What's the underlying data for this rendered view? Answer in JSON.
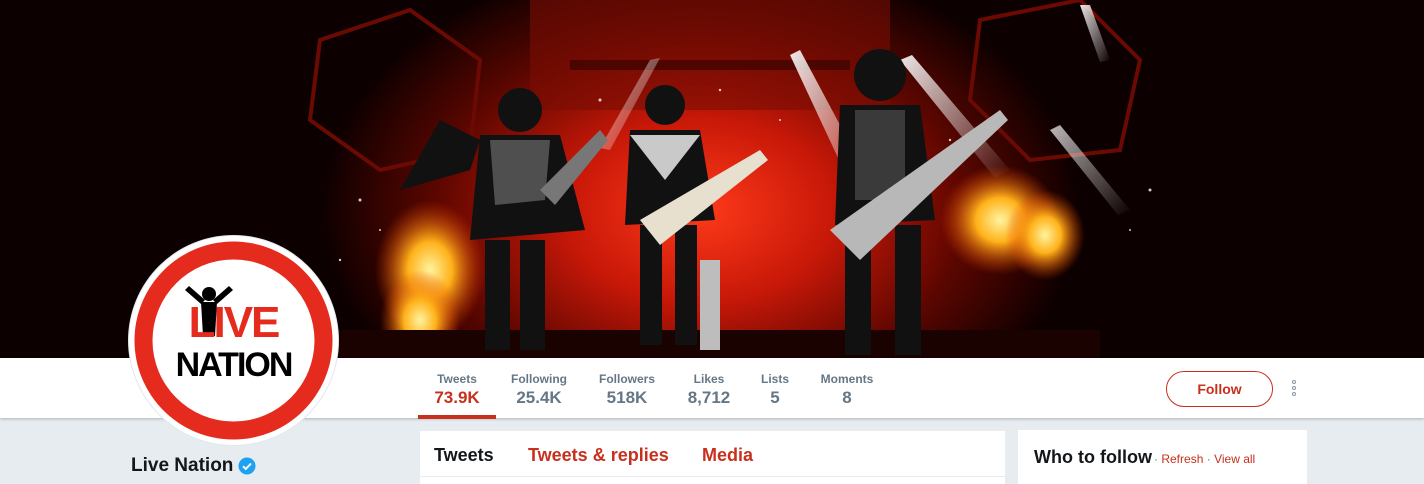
{
  "profile": {
    "name": "Live Nation",
    "logo_text_top": "LIVE",
    "logo_text_bottom": "NATION",
    "verified": true
  },
  "stats": [
    {
      "label": "Tweets",
      "value": "73.9K",
      "active": true
    },
    {
      "label": "Following",
      "value": "25.4K"
    },
    {
      "label": "Followers",
      "value": "518K"
    },
    {
      "label": "Likes",
      "value": "8,712"
    },
    {
      "label": "Lists",
      "value": "5"
    },
    {
      "label": "Moments",
      "value": "8"
    }
  ],
  "actions": {
    "follow_label": "Follow",
    "more_icon": "more-vertical-icon"
  },
  "timeline_tabs": [
    {
      "label": "Tweets",
      "active": true
    },
    {
      "label": "Tweets & replies"
    },
    {
      "label": "Media"
    }
  ],
  "who_to_follow": {
    "title": "Who to follow",
    "separator": "·",
    "refresh_label": "Refresh",
    "view_all_label": "View all"
  },
  "colors": {
    "accent": "#c8301e",
    "verified": "#1da1f2",
    "background": "#e6ecf0",
    "muted_text": "#657786",
    "logo_red": "#e42b1e"
  }
}
